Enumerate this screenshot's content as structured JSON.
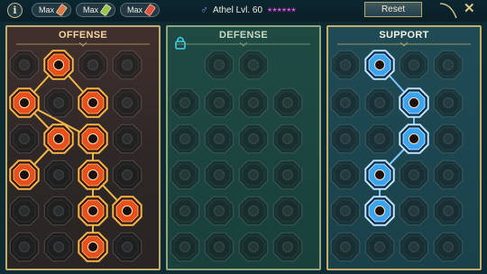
{
  "topbar": {
    "info_label": "i",
    "tomes": [
      {
        "label": "Max",
        "icon": "scroll-tome-icon",
        "color": "#d97a4a"
      },
      {
        "label": "Max",
        "icon": "green-tome-icon",
        "color": "#9bc24a"
      },
      {
        "label": "Max",
        "icon": "red-tome-icon",
        "color": "#e0503a"
      }
    ],
    "champion": "Athel Lvl. 60",
    "stars": "★★★★★★",
    "reset_label": "Reset",
    "close_label": "✕"
  },
  "panels": {
    "offense": {
      "title": "OFFENSE",
      "accent": "#e7501c"
    },
    "defense": {
      "title": "DEFENSE",
      "accent": "#5a8a76"
    },
    "support": {
      "title": "SUPPORT",
      "accent": "#3aa4f0"
    }
  },
  "trees": {
    "offense": {
      "active": [
        [
          0,
          1
        ],
        [
          1,
          0
        ],
        [
          1,
          2
        ],
        [
          2,
          1
        ],
        [
          2,
          2
        ],
        [
          3,
          0
        ],
        [
          3,
          2
        ],
        [
          4,
          2
        ],
        [
          4,
          3
        ],
        [
          5,
          2
        ]
      ],
      "links": [
        [
          [
            0,
            1
          ],
          [
            1,
            0
          ]
        ],
        [
          [
            0,
            1
          ],
          [
            1,
            2
          ]
        ],
        [
          [
            1,
            0
          ],
          [
            2,
            1
          ]
        ],
        [
          [
            1,
            0
          ],
          [
            2,
            2
          ]
        ],
        [
          [
            2,
            1
          ],
          [
            3,
            0
          ]
        ],
        [
          [
            2,
            2
          ],
          [
            3,
            2
          ]
        ],
        [
          [
            3,
            2
          ],
          [
            4,
            2
          ]
        ],
        [
          [
            3,
            2
          ],
          [
            4,
            3
          ]
        ],
        [
          [
            4,
            2
          ],
          [
            5,
            2
          ]
        ]
      ],
      "icons": {
        "0,1": "blade-burst-icon",
        "1,0": "claws-icon",
        "1,2": "heart-pierce-icon",
        "2,1": "fang-mask-icon",
        "2,2": "skull-flame-icon",
        "3,0": "crossbow-icon",
        "3,2": "axe-icon",
        "4,2": "sword-sweep-icon",
        "4,3": "berserker-icon",
        "5,2": "demon-roar-icon"
      }
    },
    "defense": {
      "active": [],
      "links": [],
      "icons": {}
    },
    "support": {
      "active": [
        [
          0,
          1
        ],
        [
          1,
          2
        ],
        [
          2,
          2
        ],
        [
          3,
          1
        ],
        [
          4,
          1
        ]
      ],
      "links": [
        [
          [
            0,
            1
          ],
          [
            1,
            2
          ]
        ],
        [
          [
            1,
            2
          ],
          [
            2,
            2
          ]
        ],
        [
          [
            2,
            2
          ],
          [
            3,
            1
          ]
        ],
        [
          [
            3,
            1
          ],
          [
            4,
            1
          ]
        ]
      ],
      "icons": {
        "0,1": "heart-sparkle-icon",
        "1,2": "skull-ward-icon",
        "2,2": "lightning-icon",
        "3,1": "comet-icon",
        "4,1": "boot-wing-icon"
      }
    }
  }
}
